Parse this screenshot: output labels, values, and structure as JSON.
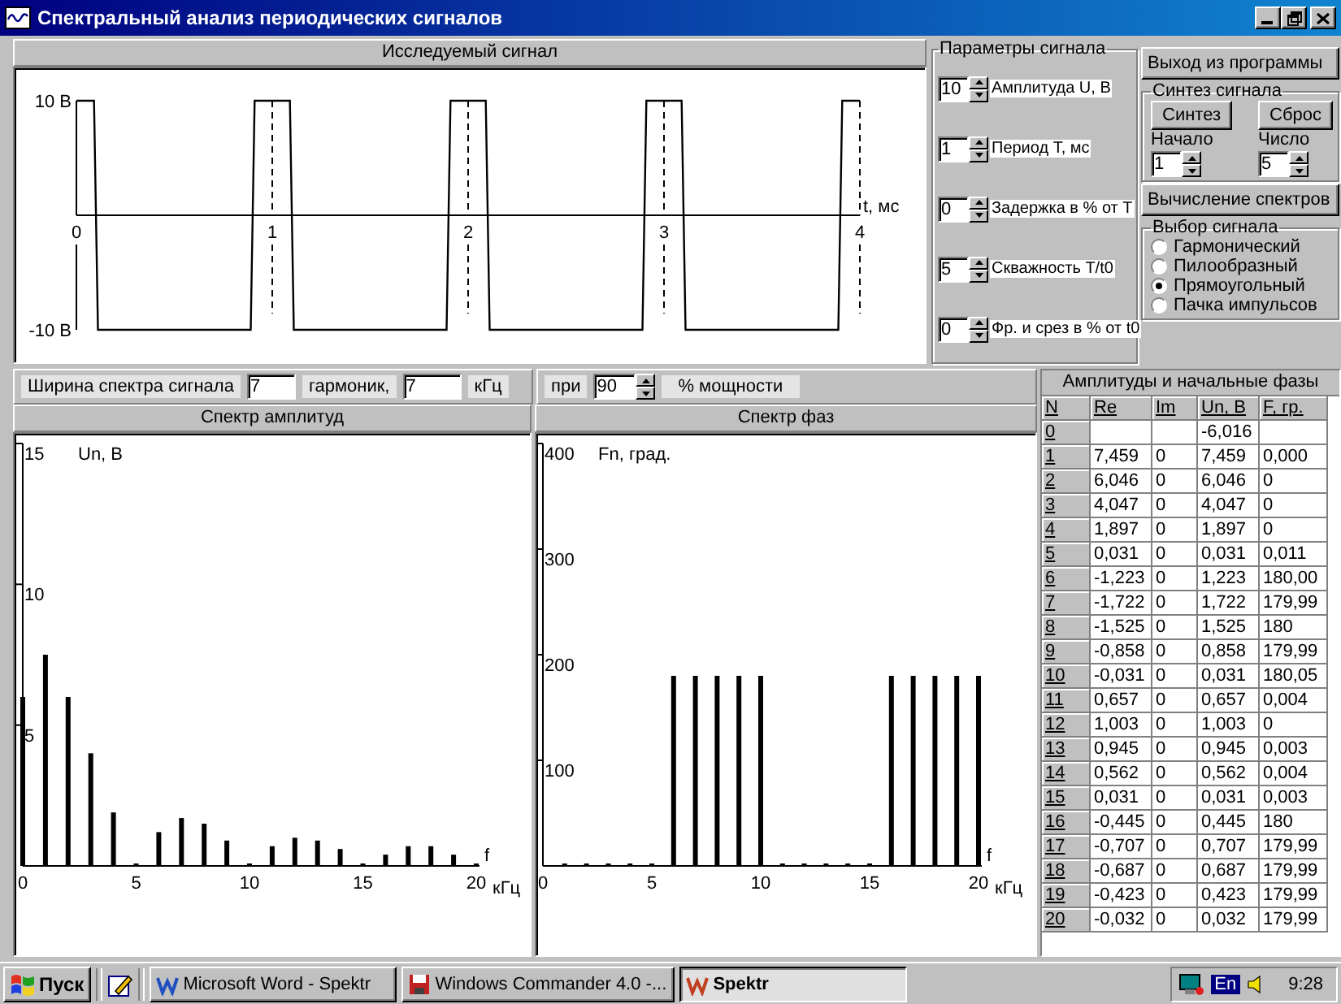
{
  "window": {
    "title": "Спектральный анализ периодических сигналов"
  },
  "signal_panel": {
    "title": "Исследуемый сигнал",
    "chart_data": {
      "type": "line",
      "xlabel": "t, мс",
      "grid": true,
      "xlim": [
        0,
        4
      ],
      "ylim": [
        -10,
        10
      ],
      "xticks": [
        0,
        1,
        2,
        3,
        4
      ],
      "yticks": [
        {
          "value": 10,
          "label": "10 В"
        },
        {
          "value": -10,
          "label": "-10 В"
        }
      ],
      "x": [
        0,
        0.09,
        0.11,
        0.89,
        0.91,
        1.09,
        1.11,
        1.89,
        1.91,
        2.09,
        2.11,
        2.89,
        2.91,
        3.09,
        3.11,
        3.89,
        3.91,
        4
      ],
      "values": [
        10,
        10,
        -10,
        -10,
        10,
        10,
        -10,
        -10,
        10,
        10,
        -10,
        -10,
        10,
        10,
        -10,
        -10,
        10,
        10
      ]
    }
  },
  "signal_params": {
    "title": "Параметры сигнала",
    "fields": [
      {
        "value": "10",
        "label": "Амплитуда U, В"
      },
      {
        "value": "1",
        "label": "Период T, мс"
      },
      {
        "value": "0",
        "label": "Задержка в % от T"
      },
      {
        "value": "5",
        "label": "Скважность T/t0"
      },
      {
        "value": "0",
        "label": "Фр. и срез в % от t0"
      }
    ]
  },
  "exit_button": "Выход из программы",
  "synthesis": {
    "title": "Синтез сигнала",
    "buttons": [
      "Синтез",
      "Сброс"
    ],
    "fields": [
      {
        "label": "Начало",
        "value": "1"
      },
      {
        "label": "Число",
        "value": "5"
      }
    ]
  },
  "compute_button": "Вычисление спектров",
  "signal_choice": {
    "title": "Выбор сигнала",
    "options": [
      {
        "label": "Гармонический",
        "selected": false
      },
      {
        "label": "Пилообразный",
        "selected": false
      },
      {
        "label": "Прямоугольный",
        "selected": true
      },
      {
        "label": "Пачка импульсов",
        "selected": false
      }
    ]
  },
  "bandwidth": {
    "label": "Ширина спектра сигнала",
    "harmonics": "7",
    "harmonics_label": "гармоник,",
    "khz": "7",
    "khz_label": "кГц",
    "at_label": "при",
    "percent": "90",
    "percent_label": "% мощности"
  },
  "amplitude_spectrum": {
    "title": "Спектр амплитуд",
    "x_unit": "кГц",
    "chart_data": {
      "type": "bar",
      "xlabel": "f",
      "ylabel": "Un, В",
      "xlim": [
        0,
        20
      ],
      "ylim": [
        0,
        15
      ],
      "xticks": [
        0,
        5,
        10,
        15,
        20
      ],
      "yticks": [
        5,
        10,
        15
      ],
      "x": [
        0,
        1,
        2,
        3,
        4,
        5,
        6,
        7,
        8,
        9,
        10,
        11,
        12,
        13,
        14,
        15,
        16,
        17,
        18,
        19,
        20
      ],
      "values": [
        6.0,
        7.5,
        6.0,
        4.0,
        1.9,
        0.0,
        1.2,
        1.7,
        1.5,
        0.9,
        0.0,
        0.7,
        1.0,
        0.9,
        0.6,
        0.0,
        0.4,
        0.7,
        0.7,
        0.4,
        0.0
      ]
    }
  },
  "phase_spectrum": {
    "title": "Спектр фаз",
    "x_unit": "кГц",
    "chart_data": {
      "type": "bar",
      "xlabel": "f",
      "ylabel": "Fn, град.",
      "xlim": [
        0,
        20
      ],
      "ylim": [
        0,
        400
      ],
      "xticks": [
        0,
        5,
        10,
        15,
        20
      ],
      "yticks": [
        100,
        200,
        300,
        400
      ],
      "x": [
        1,
        2,
        3,
        4,
        5,
        6,
        7,
        8,
        9,
        10,
        11,
        12,
        13,
        14,
        15,
        16,
        17,
        18,
        19,
        20
      ],
      "values": [
        0,
        0,
        0,
        0,
        0,
        180,
        180,
        180,
        180,
        180,
        0,
        0,
        0,
        0,
        0,
        180,
        180,
        180,
        180,
        180
      ]
    }
  },
  "table": {
    "title": "Амплитуды и начальные фазы",
    "columns": [
      "N",
      "Re",
      "Im",
      "Un, В",
      "F, гр."
    ],
    "rows": [
      [
        "0",
        null,
        null,
        "-6,016",
        null
      ],
      [
        "1",
        "7,459",
        "0",
        "7,459",
        "0,000"
      ],
      [
        "2",
        "6,046",
        "0",
        "6,046",
        "0"
      ],
      [
        "3",
        "4,047",
        "0",
        "4,047",
        "0"
      ],
      [
        "4",
        "1,897",
        "0",
        "1,897",
        "0"
      ],
      [
        "5",
        "0,031",
        "0",
        "0,031",
        "0,011"
      ],
      [
        "6",
        "-1,223",
        "0",
        "1,223",
        "180,00"
      ],
      [
        "7",
        "-1,722",
        "0",
        "1,722",
        "179,99"
      ],
      [
        "8",
        "-1,525",
        "0",
        "1,525",
        "180"
      ],
      [
        "9",
        "-0,858",
        "0",
        "0,858",
        "179,99"
      ],
      [
        "10",
        "-0,031",
        "0",
        "0,031",
        "180,05"
      ],
      [
        "11",
        "0,657",
        "0",
        "0,657",
        "0,004"
      ],
      [
        "12",
        "1,003",
        "0",
        "1,003",
        "0"
      ],
      [
        "13",
        "0,945",
        "0",
        "0,945",
        "0,003"
      ],
      [
        "14",
        "0,562",
        "0",
        "0,562",
        "0,004"
      ],
      [
        "15",
        "0,031",
        "0",
        "0,031",
        "0,003"
      ],
      [
        "16",
        "-0,445",
        "0",
        "0,445",
        "180"
      ],
      [
        "17",
        "-0,707",
        "0",
        "0,707",
        "179,99"
      ],
      [
        "18",
        "-0,687",
        "0",
        "0,687",
        "179,99"
      ],
      [
        "19",
        "-0,423",
        "0",
        "0,423",
        "179,99"
      ],
      [
        "20",
        "-0,032",
        "0",
        "0,032",
        "179,99"
      ]
    ]
  },
  "taskbar": {
    "start": "Пуск",
    "tasks": [
      {
        "label": "Microsoft Word - Spektr",
        "selected": false
      },
      {
        "label": "Windows Commander 4.0 -...",
        "selected": false
      },
      {
        "label": "Spektr",
        "selected": true
      }
    ],
    "language": "En",
    "clock": "9:28"
  }
}
